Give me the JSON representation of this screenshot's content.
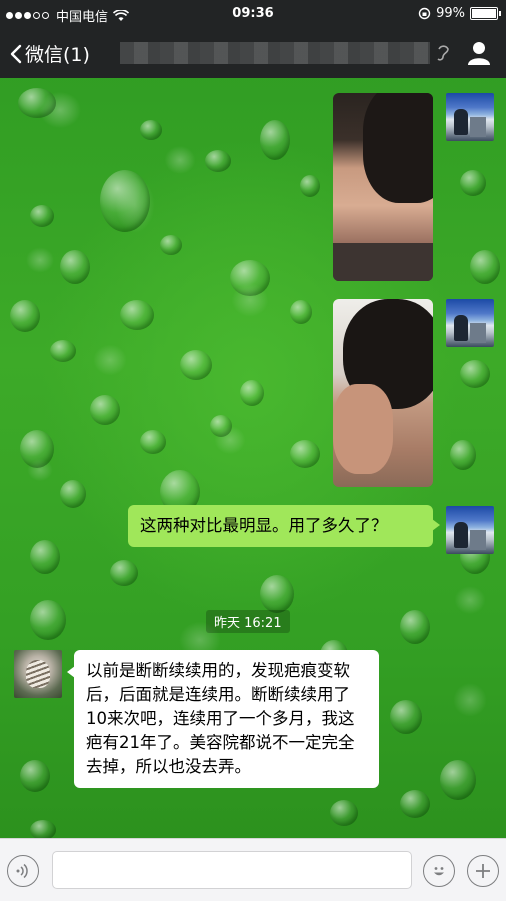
{
  "status_bar": {
    "carrier": "中国电信",
    "time": "09:36",
    "battery_percent": "99%",
    "battery_level": 0.99
  },
  "nav": {
    "back_label": "微信(1)",
    "title": "",
    "contact_icon": "person-icon"
  },
  "messages": [
    {
      "from": "me",
      "type": "image",
      "description": ""
    },
    {
      "from": "me",
      "type": "image",
      "description": ""
    },
    {
      "from": "me",
      "type": "text",
      "text": "这两种对比最明显。用了多久了？"
    },
    {
      "from": "other",
      "type": "text",
      "text": "以前是断断续续用的，发现疤痕变软后，后面就是连续用。断断续续用了10来次吧，连续用了一个多月，我这疤有21年了。美容院都说不一定完全去掉，所以也没去弄。"
    }
  ],
  "timestamp": "昨天 16:21",
  "input_bar": {
    "placeholder": "",
    "voice_icon": "voice-icon",
    "emoji_icon": "emoji-icon",
    "plus_icon": "plus-icon"
  },
  "colors": {
    "bar": "#222425",
    "my_bubble": "#a0e75a",
    "other_bubble": "#ffffff",
    "wallpaper": "#3daa28"
  }
}
